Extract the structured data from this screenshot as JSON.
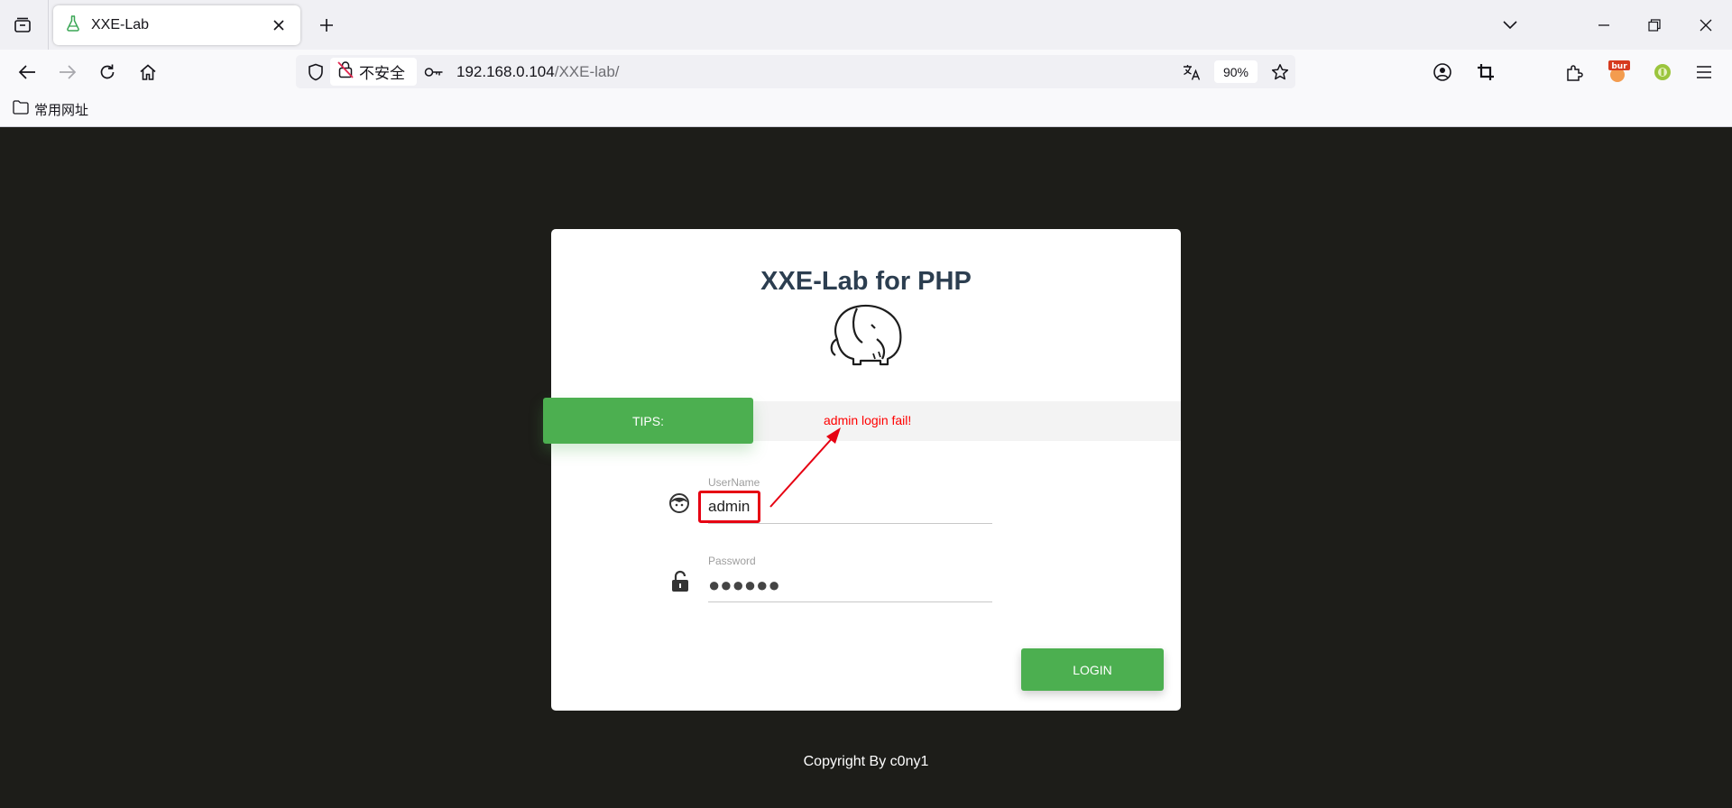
{
  "browser": {
    "tab": {
      "title": "XXE-Lab"
    },
    "urlbar": {
      "security_label": "不安全",
      "host": "192.168.0.104",
      "path": "/XXE-lab/",
      "zoom": "90%"
    },
    "bookmarks": [
      {
        "label": "常用网址"
      }
    ],
    "extension_badge": "bur"
  },
  "page": {
    "title": "XXE-Lab for PHP",
    "tips": {
      "label": "TIPS:",
      "message": "admin login fail!"
    },
    "username": {
      "label": "UserName",
      "value": "admin"
    },
    "password": {
      "label": "Password",
      "value": "●●●●●●"
    },
    "login_label": "LOGIN",
    "footer": "Copyright By c0ny1"
  },
  "colors": {
    "accent": "#4caf50",
    "error": "#ff0000",
    "highlight_box": "#e60012",
    "background": "#1d1d19",
    "title": "#2c3e50"
  }
}
